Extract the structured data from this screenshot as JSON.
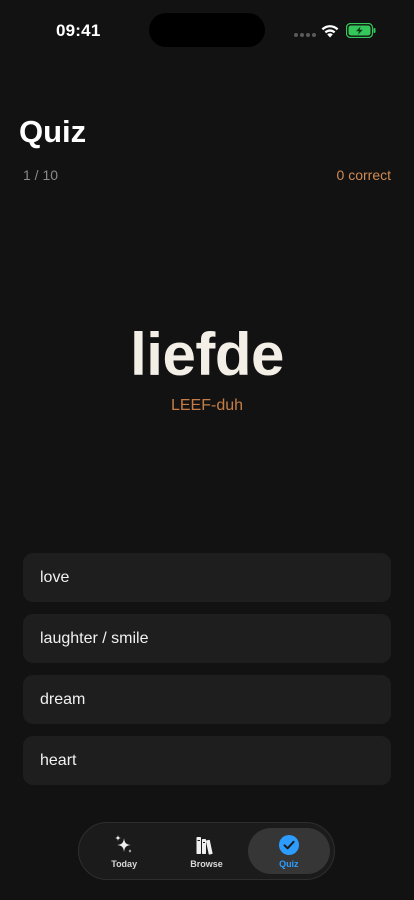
{
  "status_bar": {
    "time": "09:41"
  },
  "header": {
    "title": "Quiz",
    "progress": "1 / 10",
    "correct": "0 correct"
  },
  "question": {
    "word": "liefde",
    "pronunciation": "LEEF-duh"
  },
  "options": [
    {
      "label": "love"
    },
    {
      "label": "laughter / smile"
    },
    {
      "label": "dream"
    },
    {
      "label": "heart"
    }
  ],
  "tab_bar": {
    "tabs": [
      {
        "label": "Today",
        "icon": "sparkles-icon",
        "active": false
      },
      {
        "label": "Browse",
        "icon": "books-icon",
        "active": false
      },
      {
        "label": "Quiz",
        "icon": "checkmark-circle-icon",
        "active": true
      }
    ]
  },
  "colors": {
    "background": "#121212",
    "accent_orange": "#d08a52",
    "accent_blue": "#2d9cff",
    "option_bg": "#1e1e1e",
    "battery_green": "#34c759"
  }
}
